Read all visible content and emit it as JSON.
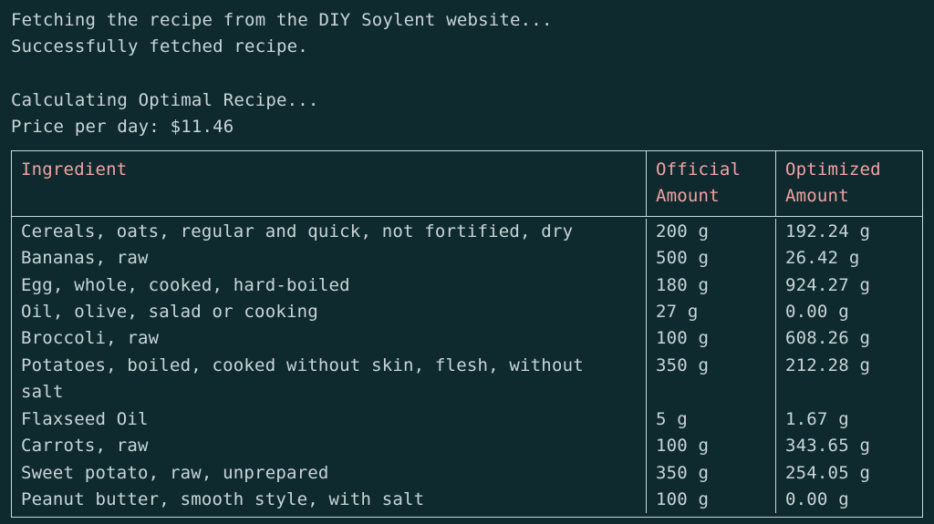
{
  "log": {
    "fetching": "Fetching the recipe from the DIY Soylent website...",
    "success": "Successfully fetched recipe.",
    "calculating": "Calculating Optimal Recipe...",
    "price_label": "Price per day: ",
    "price_value": "$11.46"
  },
  "table": {
    "headers": {
      "ingredient": "Ingredient",
      "official_l1": "Official",
      "official_l2": "Amount",
      "optimized_l1": "Optimized",
      "optimized_l2": "Amount"
    },
    "rows": [
      {
        "ingredient": "Cereals, oats, regular and quick, not fortified, dry",
        "official": "200 g",
        "optimized": "192.24 g"
      },
      {
        "ingredient": "Bananas, raw",
        "official": "500 g",
        "optimized": "26.42 g"
      },
      {
        "ingredient": "Egg, whole, cooked, hard-boiled",
        "official": "180 g",
        "optimized": "924.27 g"
      },
      {
        "ingredient": "Oil, olive, salad or cooking",
        "official": "27 g",
        "optimized": "0.00 g"
      },
      {
        "ingredient": "Broccoli, raw",
        "official": "100 g",
        "optimized": "608.26 g"
      },
      {
        "ingredient": "Potatoes, boiled, cooked without skin, flesh, without salt",
        "official": "350 g",
        "optimized": "212.28 g"
      },
      {
        "ingredient": "Flaxseed Oil",
        "official": "5 g",
        "optimized": "1.67 g"
      },
      {
        "ingredient": "Carrots, raw",
        "official": "100 g",
        "optimized": "343.65 g"
      },
      {
        "ingredient": "Sweet potato, raw, unprepared",
        "official": "350 g",
        "optimized": "254.05 g"
      },
      {
        "ingredient": "Peanut butter, smooth style, with salt",
        "official": "100 g",
        "optimized": "0.00 g"
      }
    ]
  }
}
